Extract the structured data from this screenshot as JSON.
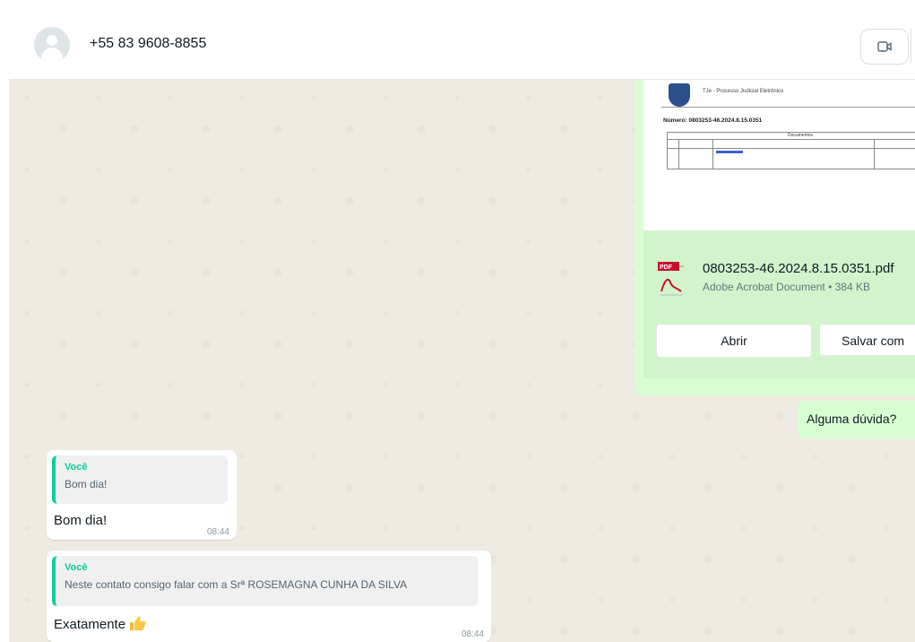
{
  "header": {
    "contact_name": "+55 83 9608-8855",
    "icons": [
      "avatar-placeholder",
      "video-call-icon"
    ]
  },
  "messages": {
    "document": {
      "preview": {
        "organization": "TJe - Processo Judicial Eletrônico",
        "number": "Número: 0803253-46.2024.8.15.0351",
        "table_title": "Documentos"
      },
      "file_name": "0803253-46.2024.8.15.0351.pdf",
      "file_meta": "Adobe Acrobat Document • 384 KB",
      "open_label": "Abrir",
      "save_label": "Salvar com"
    },
    "question": {
      "text": "Alguma dúvida?"
    },
    "incoming": [
      {
        "quote_author": "Você",
        "quote_text": "Bom dia!",
        "text": "Bom dia!",
        "time": "08:44"
      },
      {
        "quote_author": "Você",
        "quote_text": "Neste contato consigo falar com a Srª ROSEMAGNA CUNHA DA SILVA",
        "text": "Exatamente",
        "time": "08:44"
      }
    ]
  },
  "colors": {
    "outgoing_bubble": "#d9fdd3",
    "incoming_bubble": "#ffffff",
    "quote_accent": "#06cf9c",
    "chat_background": "#efeae2"
  }
}
